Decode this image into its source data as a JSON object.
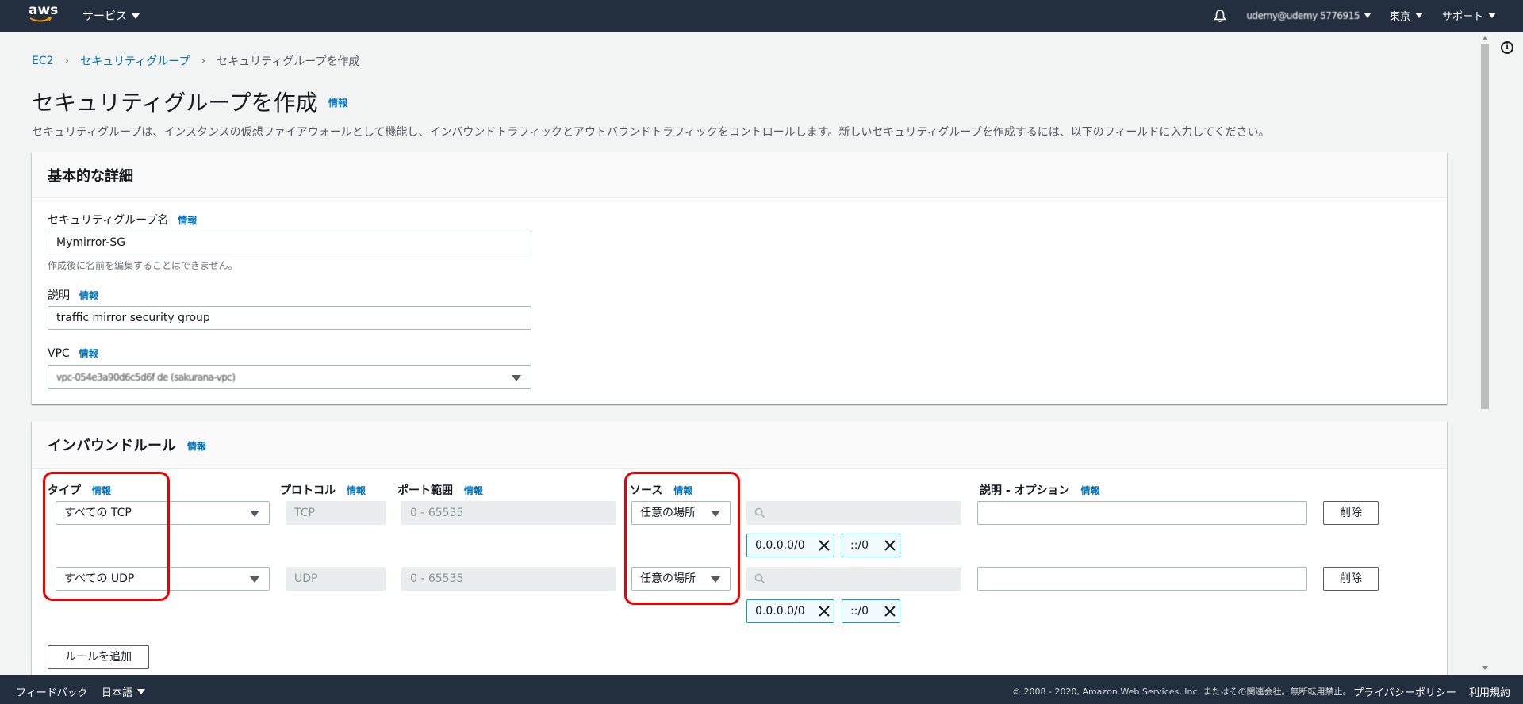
{
  "nav": {
    "logo_text": "aws",
    "services": "サービス",
    "account": "udemy@udemy 5776915",
    "region": "東京",
    "support": "サポート"
  },
  "breadcrumb": [
    "EC2",
    "セキュリティグループ",
    "セキュリティグループを作成"
  ],
  "page": {
    "title": "セキュリティグループを作成",
    "info": "情報",
    "description": "セキュリティグループは、インスタンスの仮想ファイアウォールとして機能し、インバウンドトラフィックとアウトバウンドトラフィックをコントロールします。新しいセキュリティグループを作成するには、以下のフィールドに入力してください。"
  },
  "basic": {
    "heading": "基本的な詳細",
    "name_label": "セキュリティグループ名",
    "name_value": "Mymirror-SG",
    "name_hint": "作成後に名前を編集することはできません。",
    "desc_label": "説明",
    "desc_value": "traffic mirror security group",
    "vpc_label": "VPC",
    "vpc_value": "vpc-054e3a90d6c5d6f de (sakurana-vpc)"
  },
  "inbound": {
    "heading": "インバウンドルール",
    "col_type": "タイプ",
    "col_protocol": "プロトコル",
    "col_port": "ポート範囲",
    "col_source": "ソース",
    "col_desc": "説明 - オプション",
    "rules": [
      {
        "type": "すべての TCP",
        "protocol": "TCP",
        "port": "0 - 65535",
        "source": "任意の場所",
        "cidr4": "0.0.0.0/0",
        "cidr6": "::/0",
        "delete": "削除"
      },
      {
        "type": "すべての UDP",
        "protocol": "UDP",
        "port": "0 - 65535",
        "source": "任意の場所",
        "cidr4": "0.0.0.0/0",
        "cidr6": "::/0",
        "delete": "削除"
      }
    ],
    "add_rule": "ルールを追加"
  },
  "footer": {
    "feedback": "フィードバック",
    "language": "日本語",
    "copyright": "© 2008 - 2020, Amazon Web Services, Inc. またはその関連会社。無断転用禁止。",
    "privacy": "プライバシーポリシー",
    "terms": "利用規約"
  },
  "colors": {
    "nav_bg": "#232f3e",
    "link": "#0073bb",
    "highlight": "#ee0000"
  }
}
